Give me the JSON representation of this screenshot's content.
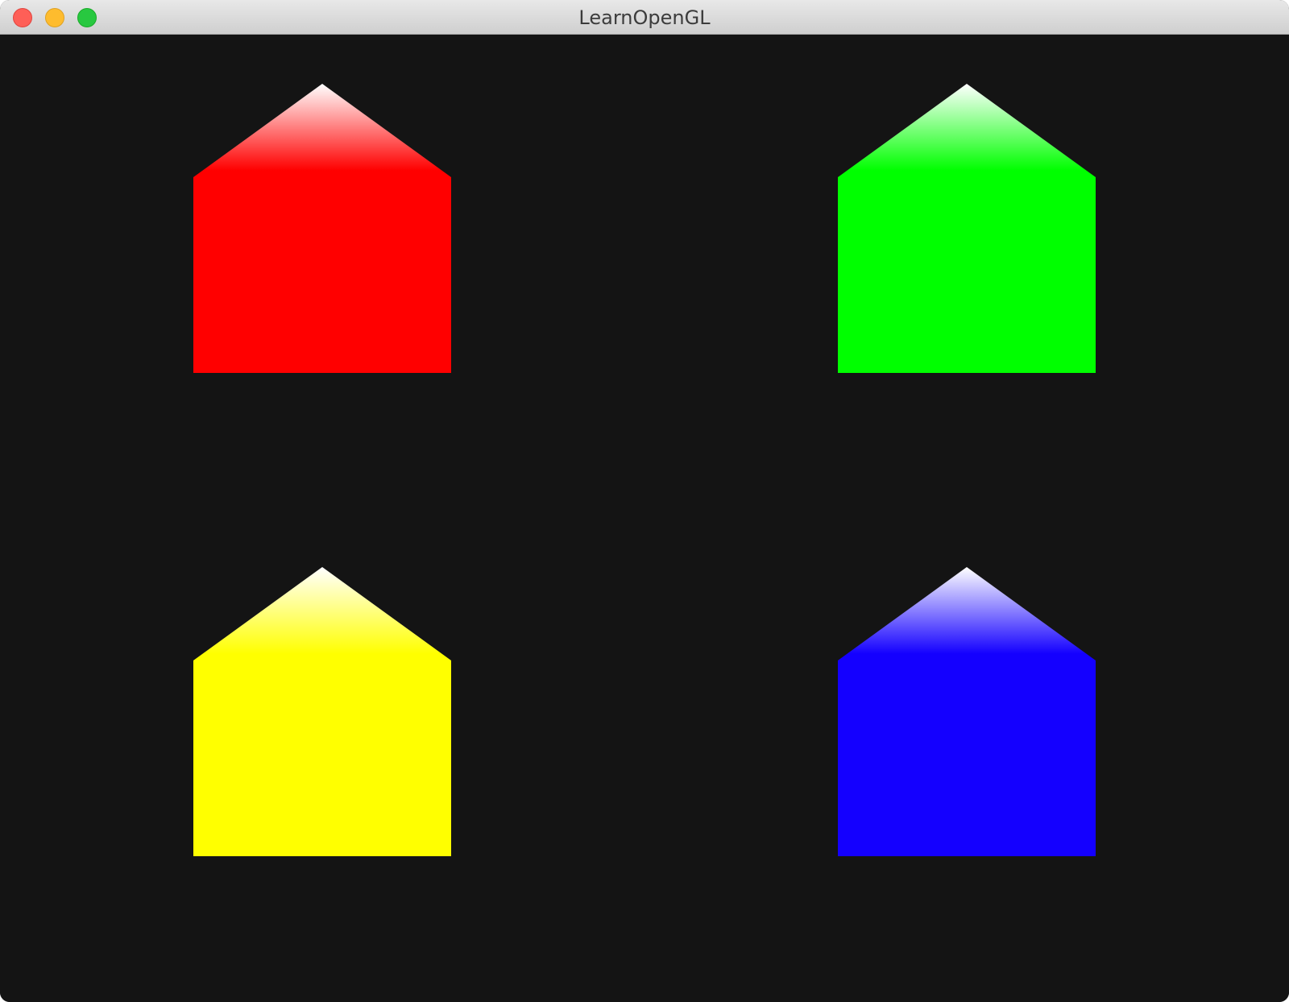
{
  "window": {
    "title": "LearnOpenGL",
    "controls": [
      "close",
      "minimize",
      "zoom"
    ]
  },
  "scene": {
    "background_color": "#141414",
    "shapes": [
      {
        "name": "red-house",
        "shape": "house",
        "color": "#ff0000",
        "tip_color": "#ffffff"
      },
      {
        "name": "green-house",
        "shape": "house",
        "color": "#00ff00",
        "tip_color": "#ffffff"
      },
      {
        "name": "yellow-house",
        "shape": "house",
        "color": "#ffff00",
        "tip_color": "#ffffff"
      },
      {
        "name": "blue-house",
        "shape": "house",
        "color": "#1400ff",
        "tip_color": "#ffffff"
      }
    ]
  }
}
